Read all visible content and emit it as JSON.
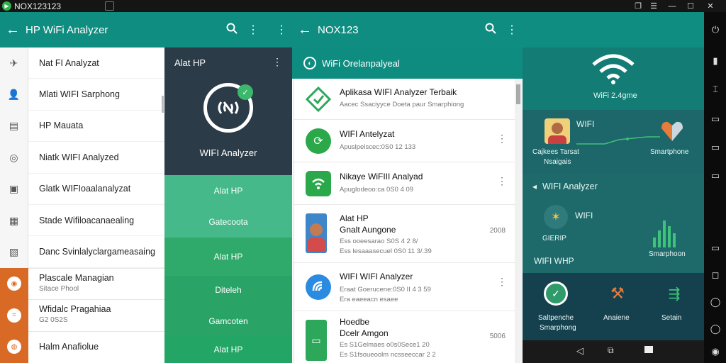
{
  "window": {
    "title": "NOX123123",
    "controls": [
      "pin-icon",
      "menu-icon",
      "minimize-icon",
      "maximize-icon",
      "close-icon"
    ]
  },
  "pane1": {
    "appbar": {
      "title": "HP WiFi Analyzer"
    },
    "nav_items": [
      "Nat FI Analyzat",
      "Mlati WIFI Sarphong",
      "HP Mauata",
      "Niatk WIFI Analyzed",
      "Glatk WIFIoaalanalyzat",
      "Stade Wifiloacanaealing",
      "Danc Svinlalyclargameasaing"
    ],
    "nav_items_with_sub": [
      {
        "title": "Plascale Managian",
        "sub": "Sitace Phool"
      },
      {
        "title": "Wfidalc Pragahiaa",
        "sub": "G2 0S2S"
      },
      {
        "title": "Halm Anafiolue",
        "sub": ""
      }
    ],
    "panel": {
      "header": "Alat HP",
      "app_name": "WIFI Analyzer",
      "items": [
        "Alat HP",
        "Gatecoota",
        "Alat HP",
        "Diteleh",
        "Gamcoten",
        "Alat HP"
      ]
    }
  },
  "pane2": {
    "appbar": {
      "title": "NOX123"
    },
    "subbar": {
      "title": "WiFi Orelanpalyeal"
    },
    "apps": [
      {
        "title": "Aplikasa WIFI Analyzer Terbaik",
        "sub": "Aacec Ssaciyyce Doeta paur Smarphiong",
        "num": ""
      },
      {
        "title": "WIFI Antelyzat",
        "sub": "Apuslpelscec:0S0 12 133",
        "num": ""
      },
      {
        "title": "Nikaye WiFIII Analyad",
        "sub": "Apuglodeoo:ca 0S0 4 09",
        "num": ""
      },
      {
        "title": "Alat HP",
        "title2": "Gnalt Aungone",
        "sub": "Ess ooeesarao S0S 4 2 8/",
        "sub2": "Ess lesaaasecuel 0S0 11 3/.39",
        "num": "2008"
      },
      {
        "title": "WIFI WIFI Analyzer",
        "sub": "Eraat Goerucene:0S0 II 4 3 59",
        "sub2": "Era eaeeacn esaee",
        "num": ""
      },
      {
        "title": "Hoedbe",
        "title2": "Dcelr Amgon",
        "sub": "Es S1Gelmaes o0s0Sece1 20",
        "sub2": "Es S1fsoueoolm ncsseeccar 2 2",
        "num": "5006"
      }
    ],
    "more_icon": "⋮"
  },
  "pane3": {
    "wifi_label": "WiFi 2.4gme",
    "row1": {
      "left_title": "Cajkees Tarsat",
      "left_sub": "Nsaigais",
      "center": "WIFI",
      "right": "Smartphone"
    },
    "heading": "WIFI Analyzer",
    "row2": {
      "left": "GIERIP",
      "center": "WIFI",
      "right": "Smarphoon"
    },
    "subheading": "WIFI WHP",
    "row3": [
      {
        "label": "Saltpenche",
        "label2": "Smarphong"
      },
      {
        "label": "Anaiene",
        "label2": ""
      },
      {
        "label": "Setain",
        "label2": ""
      }
    ]
  },
  "emulator_toolbar": [
    "power-icon",
    "multiwindow-icon",
    "keyboard-icon",
    "screen-icon",
    "pc-icon",
    "settings-icon",
    "back-icon",
    "record-icon",
    "volume-icon",
    "more-icon"
  ],
  "colors": {
    "teal": "#0e8d80",
    "dark": "#2b3b47",
    "green1": "#43b88a",
    "green2": "#2faa6a",
    "orange": "#d86a26"
  }
}
